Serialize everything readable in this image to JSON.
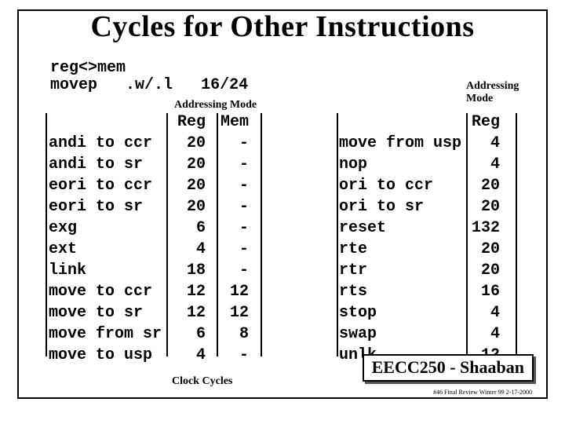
{
  "title": "Cycles for Other Instructions",
  "top": {
    "l1": "reg<>mem",
    "l2_a": "movep",
    "l2_b": ".w/.l",
    "l2_c": "16/24"
  },
  "am_label": "Addressing Mode",
  "clock_label": "Clock Cycles",
  "left": {
    "hdr_reg": "Reg",
    "hdr_mem": "Mem",
    "rows": [
      {
        "i": "andi to ccr",
        "r": "20",
        "m": "-"
      },
      {
        "i": "andi to sr",
        "r": "20",
        "m": "-"
      },
      {
        "i": "eori to ccr",
        "r": "20",
        "m": "-"
      },
      {
        "i": "eori to sr",
        "r": "20",
        "m": "-"
      },
      {
        "i": "exg",
        "r": "6",
        "m": "-"
      },
      {
        "i": "ext",
        "r": "4",
        "m": "-"
      },
      {
        "i": "link",
        "r": "18",
        "m": "-"
      },
      {
        "i": "move to ccr",
        "r": "12",
        "m": "12"
      },
      {
        "i": "move to sr",
        "r": "12",
        "m": "12"
      },
      {
        "i": "move from sr",
        "r": "6",
        "m": "8"
      },
      {
        "i": "move to usp",
        "r": "4",
        "m": "-"
      }
    ]
  },
  "right": {
    "hdr_reg": "Reg",
    "rows": [
      {
        "i": "move from usp",
        "r": "4"
      },
      {
        "i": "nop",
        "r": "4"
      },
      {
        "i": "ori to ccr",
        "r": "20"
      },
      {
        "i": "ori to sr",
        "r": "20"
      },
      {
        "i": "reset",
        "r": "132"
      },
      {
        "i": "rte",
        "r": "20"
      },
      {
        "i": "rtr",
        "r": "20"
      },
      {
        "i": "rts",
        "r": "16"
      },
      {
        "i": "stop",
        "r": "4"
      },
      {
        "i": "swap",
        "r": "4"
      },
      {
        "i": "unlk",
        "r": "12"
      }
    ]
  },
  "footer": "EECC250 - Shaaban",
  "tiny": "#46 Final Review Winter 99  2-17-2000"
}
